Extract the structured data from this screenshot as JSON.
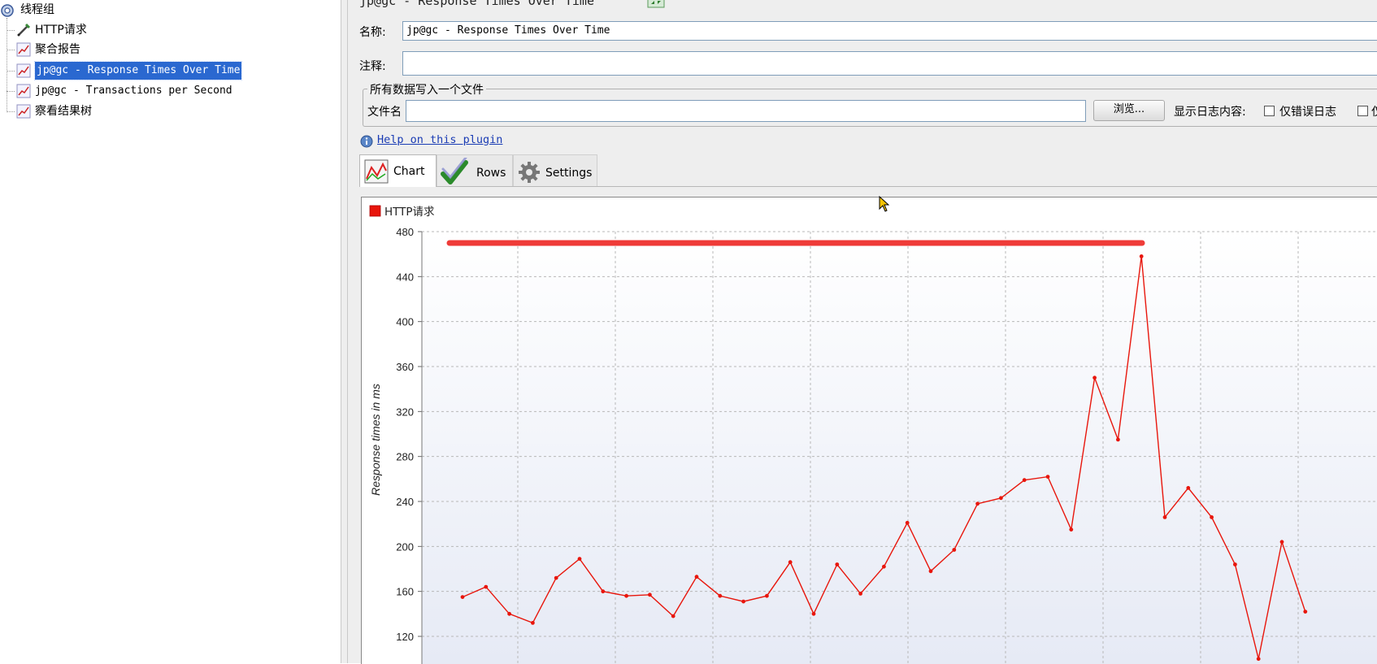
{
  "tree": {
    "root_label": "线程组",
    "items": [
      {
        "label": "HTTP请求",
        "icon": "sampler-pen-icon"
      },
      {
        "label": "聚合报告",
        "icon": "listener-graph-icon"
      },
      {
        "label": "jp@gc - Response Times Over Time",
        "icon": "listener-graph-icon",
        "selected": true
      },
      {
        "label": "jp@gc - Transactions per Second",
        "icon": "listener-graph-icon"
      },
      {
        "label": "察看结果树",
        "icon": "listener-graph-icon"
      }
    ]
  },
  "panel": {
    "title": "jp@gc - Response Times Over Time",
    "name_label": "名称:",
    "name_value": "jp@gc - Response Times Over Time",
    "comment_label": "注释:",
    "comment_value": "",
    "file_group_title": "所有数据写入一个文件",
    "filename_label": "文件名",
    "filename_value": "",
    "browse_button": "浏览...",
    "log_content_label": "显示日志内容:",
    "errors_only_label": "仅错误日志",
    "success_only_label": "仅",
    "help_link": "Help on this plugin",
    "tabs": [
      {
        "label": "Chart",
        "icon": "chart-icon",
        "active": true
      },
      {
        "label": "Rows",
        "icon": "checkmark-rows-icon",
        "active": false
      },
      {
        "label": "Settings",
        "icon": "gear-icon",
        "active": false
      }
    ]
  },
  "chart_data": {
    "type": "line",
    "title": "",
    "ylabel": "Response times in ms",
    "xlabel": "",
    "ylim": [
      100,
      480
    ],
    "yticks": [
      480,
      440,
      400,
      360,
      320,
      280,
      240,
      200,
      160,
      120
    ],
    "grid": true,
    "legend_position": "top-left",
    "series": [
      {
        "name": "HTTP请求",
        "color": "#e8160c",
        "values": [
          155,
          164,
          140,
          132,
          172,
          189,
          160,
          156,
          157,
          138,
          173,
          156,
          151,
          156,
          186,
          140,
          184,
          158,
          182,
          221,
          178,
          197,
          238,
          243,
          259,
          262,
          215,
          350,
          295,
          458,
          226,
          252,
          226,
          184,
          100,
          204,
          142
        ]
      }
    ]
  },
  "colors": {
    "selection": "#2a68d0",
    "series": "#e8160c",
    "annotation": "#ef3b38",
    "link": "#1a3cb4"
  }
}
